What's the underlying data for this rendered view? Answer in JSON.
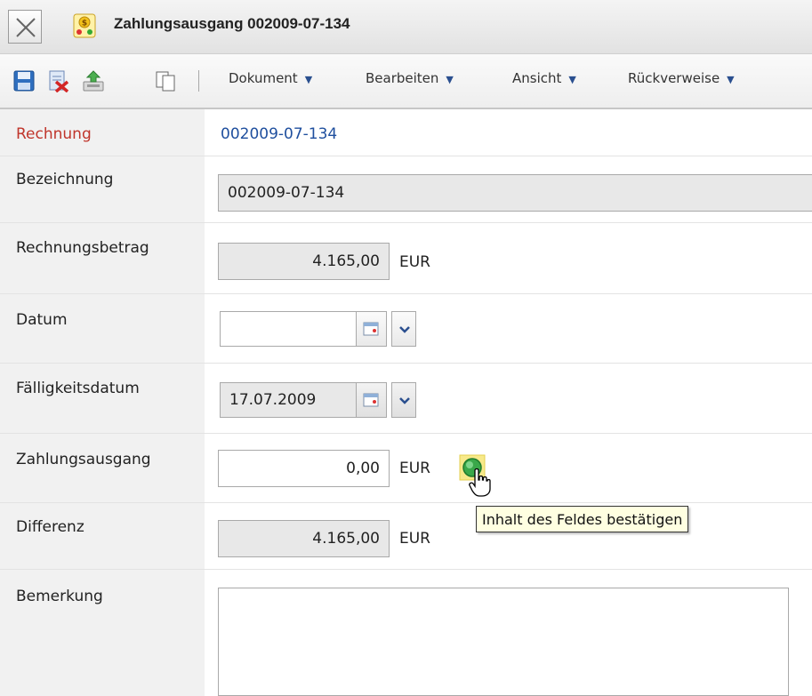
{
  "window": {
    "title": "Zahlungsausgang 002009-07-134",
    "close_icon": "close-x-icon",
    "title_icon": "payment-icon"
  },
  "toolbar": {
    "icons": [
      "save-icon",
      "delete-icon",
      "export-icon",
      "copy-icon"
    ],
    "menus": [
      {
        "label": "Dokument"
      },
      {
        "label": "Bearbeiten"
      },
      {
        "label": "Ansicht"
      },
      {
        "label": "Rückverweise"
      }
    ],
    "menu_arrow": "▼"
  },
  "form": {
    "rechnung": {
      "label": "Rechnung",
      "value": "002009-07-134"
    },
    "bezeichnung": {
      "label": "Bezeichnung",
      "value": "002009-07-134"
    },
    "rechnungsbetrag": {
      "label": "Rechnungsbetrag",
      "value": "4.165,00",
      "unit": "EUR"
    },
    "datum": {
      "label": "Datum",
      "value": ""
    },
    "faelligkeitsdatum": {
      "label": "Fälligkeitsdatum",
      "value": "17.07.2009"
    },
    "zahlungsausgang": {
      "label": "Zahlungsausgang",
      "value": "0,00",
      "unit": "EUR"
    },
    "differenz": {
      "label": "Differenz",
      "value": "4.165,00",
      "unit": "EUR"
    },
    "bemerkung": {
      "label": "Bemerkung",
      "value": ""
    }
  },
  "tooltip": {
    "text": "Inhalt des Feldes bestätigen"
  },
  "colors": {
    "label_red": "#c0352b",
    "link_blue": "#1f4f9e",
    "confirm_green": "#3aa84a"
  }
}
